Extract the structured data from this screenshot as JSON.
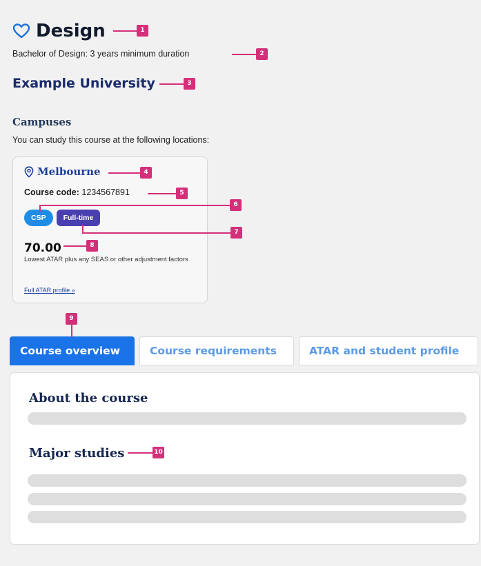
{
  "header": {
    "title": "Design",
    "subtitle": "Bachelor of Design: 3 years minimum duration",
    "university": "Example University"
  },
  "campuses": {
    "heading": "Campuses",
    "intro": "You can study this course at the following locations:",
    "card": {
      "location": "Melbourne",
      "code_label": "Course code:",
      "code_value": "1234567891",
      "badges": [
        "CSP",
        "Full-time"
      ],
      "atar_value": "70.00",
      "atar_note": "Lowest ATAR plus any SEAS or other adjustment factors",
      "atar_link": "Full ATAR profile »"
    }
  },
  "tabs": [
    {
      "label": "Course overview",
      "active": true
    },
    {
      "label": "Course requirements",
      "active": false
    },
    {
      "label": "ATAR and student profile",
      "active": false
    }
  ],
  "panel": {
    "about_heading": "About the course",
    "major_heading": "Major studies"
  },
  "callouts": [
    "1",
    "2",
    "3",
    "4",
    "5",
    "6",
    "7",
    "8",
    "9",
    "10"
  ],
  "icons": {
    "favorite": "heart-icon",
    "location": "map-pin-icon"
  },
  "colors": {
    "accent": "#1a73e8",
    "csp_badge": "#1f8de6",
    "fulltime_badge": "#4a3fb0",
    "callout": "#d4307a",
    "university": "#1b2c6b"
  }
}
